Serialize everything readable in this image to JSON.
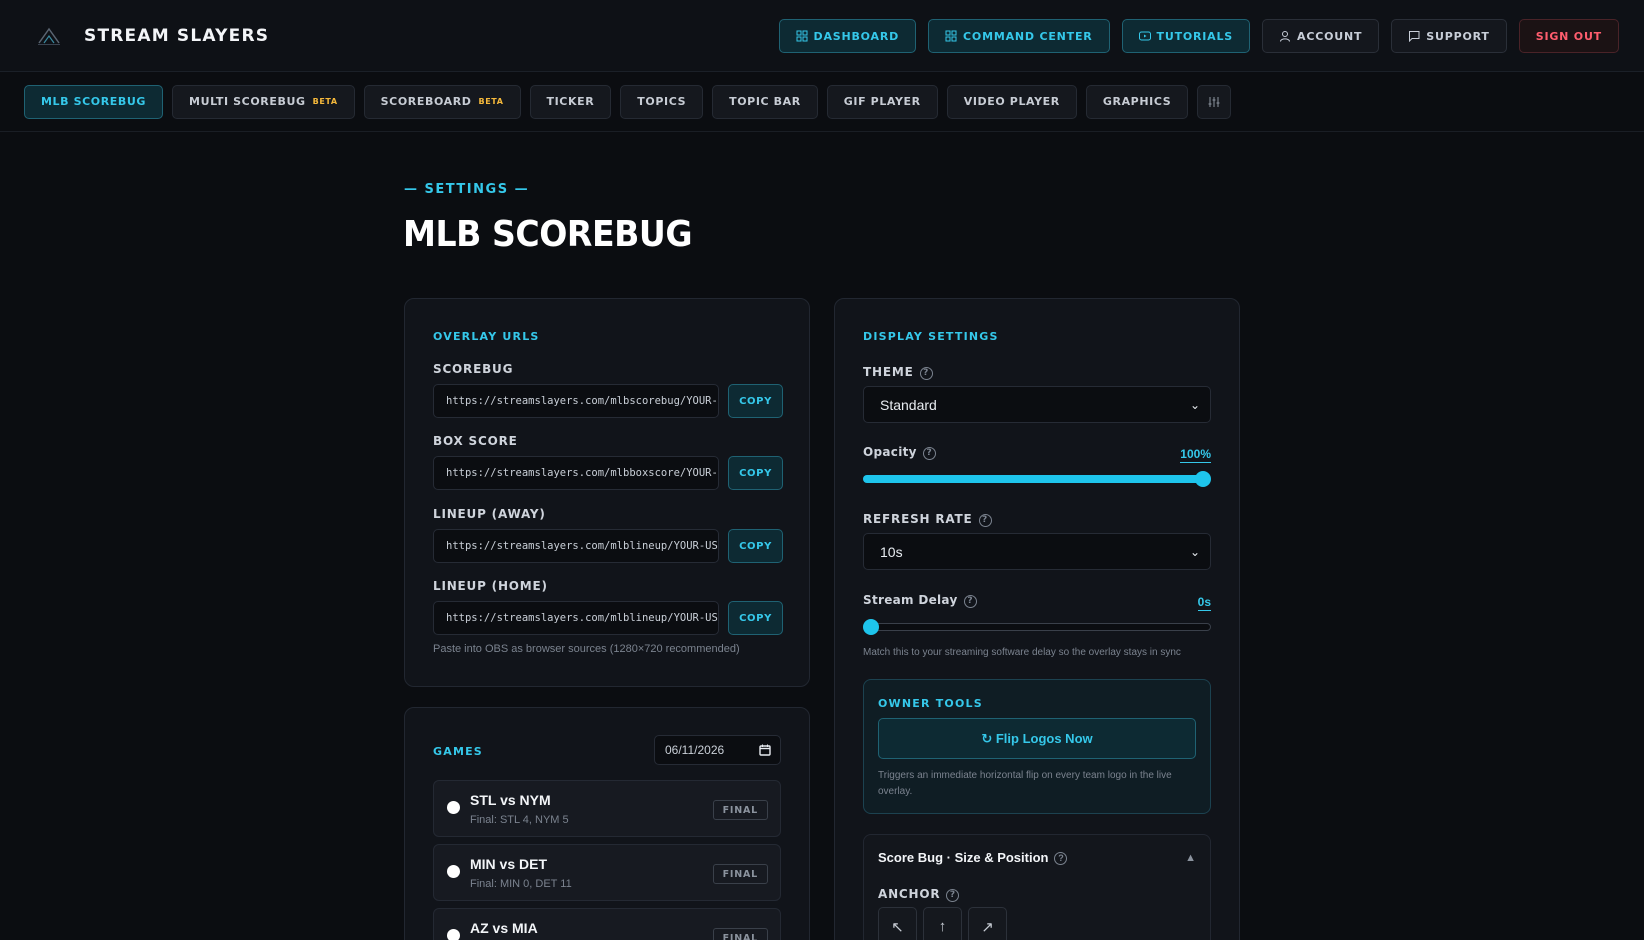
{
  "brand": {
    "name": "STREAM SLAYERS",
    "logo_icon": "mountain-logo-icon"
  },
  "topnav": [
    {
      "label": "DASHBOARD",
      "icon": "grid-icon",
      "style": "teal"
    },
    {
      "label": "COMMAND CENTER",
      "icon": "grid-icon",
      "style": "teal"
    },
    {
      "label": "TUTORIALS",
      "icon": "play-icon",
      "style": "teal"
    },
    {
      "label": "ACCOUNT",
      "icon": "user-icon",
      "style": "dark"
    },
    {
      "label": "SUPPORT",
      "icon": "chat-icon",
      "style": "dark"
    },
    {
      "label": "SIGN OUT",
      "icon": "",
      "style": "red"
    }
  ],
  "tabs": [
    {
      "label": "MLB SCOREBUG",
      "active": true,
      "badge": ""
    },
    {
      "label": "MULTI SCOREBUG",
      "active": false,
      "badge": "BETA"
    },
    {
      "label": "SCOREBOARD",
      "active": false,
      "badge": "BETA"
    },
    {
      "label": "TICKER",
      "active": false,
      "badge": ""
    },
    {
      "label": "TOPICS",
      "active": false,
      "badge": ""
    },
    {
      "label": "TOPIC BAR",
      "active": false,
      "badge": ""
    },
    {
      "label": "GIF PLAYER",
      "active": false,
      "badge": ""
    },
    {
      "label": "VIDEO PLAYER",
      "active": false,
      "badge": ""
    },
    {
      "label": "GRAPHICS",
      "active": false,
      "badge": ""
    }
  ],
  "header": {
    "eyebrow": "— SETTINGS —",
    "title": "MLB SCOREBUG"
  },
  "overlay_urls": {
    "title": "OVERLAY URLS",
    "copy_label": "COPY",
    "items": [
      {
        "label": "SCOREBUG",
        "url": "https://streamslayers.com/mlbscorebug/YOUR-"
      },
      {
        "label": "BOX SCORE",
        "url": "https://streamslayers.com/mlbboxscore/YOUR-"
      },
      {
        "label": "LINEUP (AWAY)",
        "url": "https://streamslayers.com/mlblineup/YOUR-US"
      },
      {
        "label": "LINEUP (HOME)",
        "url": "https://streamslayers.com/mlblineup/YOUR-US"
      }
    ],
    "hint": "Paste into OBS as browser sources (1280×720 recommended)"
  },
  "games": {
    "title": "GAMES",
    "date": "06/11/2026",
    "items": [
      {
        "title": "STL vs NYM",
        "sub": "Final: STL 4, NYM 5",
        "badge": "FINAL"
      },
      {
        "title": "MIN vs DET",
        "sub": "Final: MIN 0, DET 11",
        "badge": "FINAL"
      },
      {
        "title": "AZ vs MIA",
        "sub": "",
        "badge": "FINAL"
      }
    ]
  },
  "display": {
    "title": "DISPLAY SETTINGS",
    "theme_label": "THEME",
    "theme_value": "Standard",
    "opacity_label": "Opacity",
    "opacity_value": "100%",
    "opacity_fraction": 1.0,
    "refresh_label": "REFRESH RATE",
    "refresh_value": "10s",
    "delay_label": "Stream Delay",
    "delay_value": "0s",
    "delay_fraction": 0.0,
    "delay_hint": "Match this to your streaming software delay so the overlay stays in sync"
  },
  "owner_tools": {
    "title": "OWNER TOOLS",
    "button": "↻ Flip Logos Now",
    "hint": "Triggers an immediate horizontal flip on every team logo in the live overlay."
  },
  "scorebug_size": {
    "title": "Score Bug · Size & Position",
    "anchor_label": "ANCHOR",
    "anchors": [
      "↖",
      "↑",
      "↗"
    ]
  },
  "colors": {
    "accent": "#35c8ea",
    "background": "#0b0d11",
    "danger": "#ff5d6e",
    "beta": "#f6b93b"
  }
}
